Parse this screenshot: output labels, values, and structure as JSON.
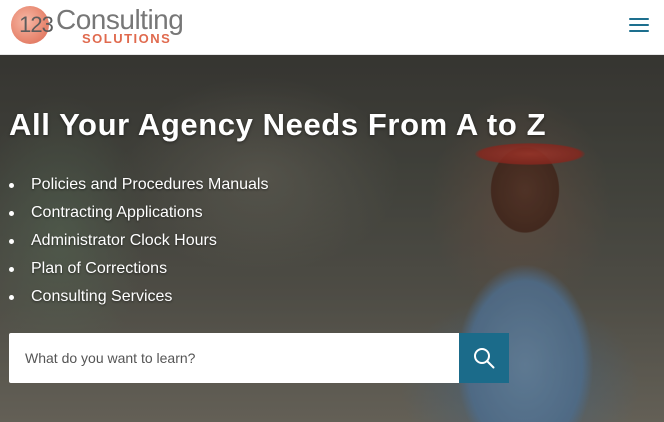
{
  "header": {
    "logo": {
      "number": "123",
      "name": "Consulting",
      "tagline": "SOLUTIONS"
    },
    "menu_icon": "hamburger-menu-icon"
  },
  "hero": {
    "title": "All Your Agency Needs From A to Z",
    "bullets": [
      "Policies and Procedures Manuals",
      "Contracting Applications",
      "Administrator Clock Hours",
      "Plan of Corrections",
      "Consulting Services"
    ],
    "search": {
      "placeholder": "What do you want to learn?",
      "value": "",
      "button_icon": "search-icon"
    }
  },
  "colors": {
    "accent": "#1b6b8a",
    "logo_orange": "#e06a4e",
    "logo_gray": "#777777"
  }
}
